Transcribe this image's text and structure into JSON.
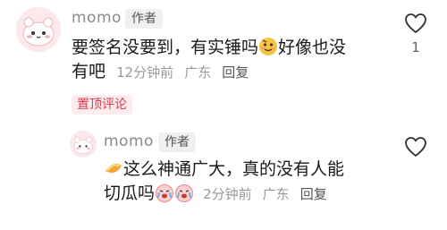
{
  "comments": [
    {
      "nickname": "momo",
      "badge": "作者",
      "text_part1": "要签名没要到，有实锤吗",
      "text_part2": "好像也没",
      "text_line2": "有吧",
      "time": "12分钟前",
      "location": "广东",
      "reply_label": "回复",
      "pin_label": "置顶评论",
      "like_count": "1"
    },
    {
      "nickname": "momo",
      "badge": "作者",
      "text_part1": "这么神通广大，真的没有人能",
      "text_line2": "切瓜吗",
      "time": "2分钟前",
      "location": "广东",
      "reply_label": "回复"
    }
  ],
  "icons": {
    "like": "heart-outline-icon",
    "avatar": "cartoon-avatar",
    "emoji1": "smirk-face-emoji",
    "emoji2": "melon-slice-emoji",
    "emoji3": "crying-face-emoji"
  },
  "colors": {
    "pin_text": "#d83a4a",
    "pin_bg": "#fdecee",
    "nickname": "#8a8a8a",
    "meta": "#9a9a9a"
  }
}
